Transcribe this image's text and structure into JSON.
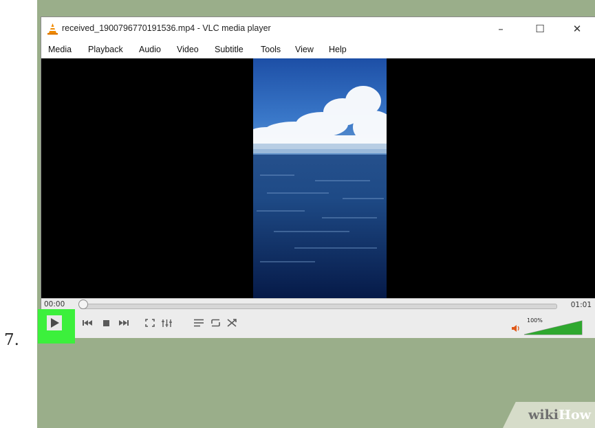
{
  "step": {
    "number": "7."
  },
  "window": {
    "title": "received_1900796770191536.mp4 - VLC media player",
    "buttons": {
      "minimize": "–",
      "maximize": "☐",
      "close": "✕"
    }
  },
  "menu": {
    "items": [
      {
        "label": "Media"
      },
      {
        "label": "Playback"
      },
      {
        "label": "Audio"
      },
      {
        "label": "Video"
      },
      {
        "label": "Subtitle"
      },
      {
        "label": "Tools"
      },
      {
        "label": "View"
      },
      {
        "label": "Help"
      }
    ]
  },
  "playback": {
    "elapsed": "00:00",
    "total": "01:01",
    "progress": 0.0,
    "volume_label": "100%",
    "volume_level": 1.0
  },
  "controls": {
    "icons": [
      "play-icon",
      "previous-icon",
      "stop-icon",
      "next-icon",
      "fullscreen-icon",
      "extended-settings-icon",
      "playlist-icon",
      "loop-icon",
      "shuffle-icon",
      "speaker-icon"
    ]
  },
  "colors": {
    "highlight": "#3cf03c",
    "volume_bar": "#2fa82f",
    "vlc_orange": "#f08a00",
    "background": "#9aae8a"
  },
  "watermark": {
    "wiki": "wiki",
    "how": "How"
  }
}
